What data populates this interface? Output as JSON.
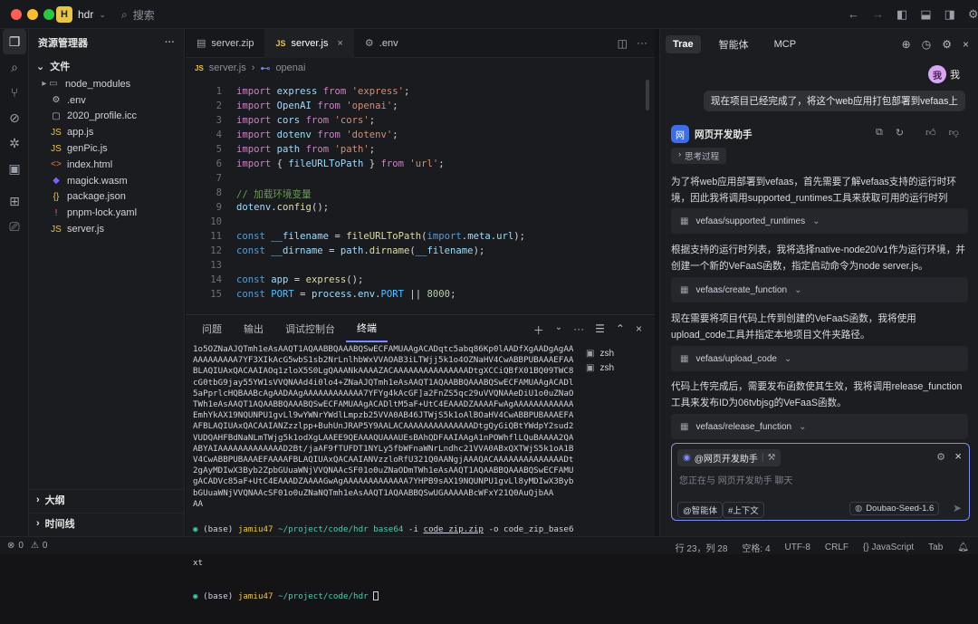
{
  "titlebar": {
    "project_badge": "H",
    "project_name": "hdr",
    "search_placeholder": "搜索"
  },
  "explorer": {
    "title": "资源管理器",
    "section": "文件",
    "files": [
      {
        "name": "node_modules",
        "icon": "folder-icon",
        "color": "#9aa0aa",
        "glyph": "▸"
      },
      {
        "name": ".env",
        "icon": "gear-icon",
        "color": "#b7bac2",
        "glyph": "⚙"
      },
      {
        "name": "2020_profile.icc",
        "icon": "file-icon",
        "color": "#b7bac2",
        "glyph": "▢"
      },
      {
        "name": "app.js",
        "icon": "js-icon",
        "color": "#e8c547",
        "glyph": "JS"
      },
      {
        "name": "genPic.js",
        "icon": "js-icon",
        "color": "#e8c547",
        "glyph": "JS"
      },
      {
        "name": "index.html",
        "icon": "html-icon",
        "color": "#e37933",
        "glyph": "<>"
      },
      {
        "name": "magick.wasm",
        "icon": "wasm-icon",
        "color": "#7b61ff",
        "glyph": "◆"
      },
      {
        "name": "package.json",
        "icon": "json-icon",
        "color": "#e8c547",
        "glyph": "{}"
      },
      {
        "name": "pnpm-lock.yaml",
        "icon": "yaml-icon",
        "color": "#e06c75",
        "glyph": "!"
      },
      {
        "name": "server.js",
        "icon": "js-icon",
        "color": "#e8c547",
        "glyph": "JS"
      }
    ],
    "outline": "大纲",
    "timeline": "时间线"
  },
  "editor": {
    "tabs": [
      {
        "label": "server.zip",
        "icon": "file-icon"
      },
      {
        "label": "server.js",
        "icon": "js-icon"
      },
      {
        "label": ".env",
        "icon": "gear-icon"
      }
    ],
    "breadcrumb": [
      "server.js",
      "openai"
    ],
    "line_numbers": [
      "1",
      "2",
      "3",
      "4",
      "5",
      "6",
      "7",
      "8",
      "9",
      "10",
      "11",
      "12",
      "13",
      "14",
      "15"
    ]
  },
  "panel": {
    "tabs": [
      "问题",
      "输出",
      "调试控制台",
      "终端"
    ],
    "shells": [
      "zsh",
      "zsh"
    ],
    "terminal_lines": [
      "1o5OZNaAJQTmh1eAsAAQT1AQAABBQAAABQSwECFAMUAAgACADqtc5abq86Kp0lAADfXgAADgAgAAAA",
      "AAAAAAAAA7YF3XIkAcG5wbS1sb2NrLnlhbWxVVAOAB3iLTWjj5k1o4OZNaHV4CwABBPUBAAAEFAAAAF",
      "BLAQIUAxQACAAIAOq1zloX5S0LgQAAANkAAAAZACAAAAAAAAAAAAAAADtgXCCiQBfX01BQ09TWC8uX3Bu",
      "cG0tbG9jay55YW1sVVQNAAd4i0lo4+ZNaAJQTmh1eAsAAQT1AQAABBQAAABQSwECFAMUAAgACADltM",
      "5aPprlcHQBAABcAgAADAAgAAAAAAAAAAAA7YFYg4kAcGF]a2FnZS5qc29uVVQNAAeDiU1o0uZNaODm",
      "TWh1eAsAAQT1AQAABBQAAABQSwECFAMUAAgACADltM5aF+UtC4EAAADZAAAAFwAgAAAAAAAAAAAA7Y",
      "EmhYkAX19NQUNPU1gvLl9wYWNrYWdlLmpzb25VVA0AB46JTWjS5k1oAlBOaHV4CwABBPUBAAAEFAAA",
      "AFBLAQIUAxQACAAIANZzzlpp+BuhUnJRAP5Y9AALACAAAAAAAAAAAAAADtgQyGiQBtYWdpY2sud2FzbV",
      "VUDQAHFBdNaNLmTWjg5k1odXgLAAEE9QEAAAQUAAAUEsBAhQDFAAIAAgA1nPOWhflLQuBAAAA2QAA",
      "ABYAIAAAAAAAAAAAAAD2Bt/jaAF9fTUFDT1NYLy5fbWFnaWNrLndhc21VVA0ABxQXTWjS5k1oA1BOaH",
      "V4CwABBPUBAAAEFAAAAFBLAQIUAxQACAAIANVzzloRfU321Q0AANgjAAAQACAAAAAAAAAAAAAADtgZz5",
      "2gAyMDIwX3Byb2ZpbGUuaWNjVVQNAAcSF01o0uZNaODmTWh1eAsAAQT1AQAABBQAAABQSwECFAMUAA",
      "gACADVc85aF+UtC4EAAADZAAAAGwAgAAAAAAAAAAAAA7YHPB9sAX19NQUNPU1gvLl8yMDIwX3Byb2Zp",
      "bGUuaWNjVVQNAAcSF01o0uZNaNQTmh1eAsAAQT1AQAABBQSwUGAAAAABcWFxY21Q0AuQjbAA",
      "AA"
    ],
    "cmd1_prompt": "(base) ",
    "cmd1_user": "jamiu47",
    "cmd1_path": " ~/project/code/hdr ",
    "cmd1_cmd": "base64",
    "cmd1_args": " -i ",
    "cmd1_in": "code_zip.zip",
    "cmd1_rest": " -o code_zip_base64.t",
    "cmd1_wrap": "xt",
    "cmd2_prompt": "(base) ",
    "cmd2_user": "jamiu47",
    "cmd2_path": " ~/project/code/hdr "
  },
  "chat": {
    "tabs": [
      "Trae",
      "智能体",
      "MCP"
    ],
    "user_label": "我",
    "user_avatar": "我",
    "user_message": "现在项目已经完成了，将这个web应用打包部署到vefaas上",
    "assistant_name": "网页开发助手",
    "assistant_avatar": "网",
    "thinking": "思考过程",
    "para1": "为了将web应用部署到vefaas，首先需要了解vefaas支持的运行时环境，因此我将调用supported_runtimes工具来获取可用的运行时列表。",
    "tool1": "vefaas/supported_runtimes",
    "para2": "根据支持的运行时列表，我将选择native-node20/v1作为运行环境，并创建一个新的VeFaaS函数，指定启动命令为node server.js。",
    "tool2": "vefaas/create_function",
    "para3": "现在需要将项目代码上传到创建的VeFaaS函数，我将使用upload_code工具并指定本地项目文件夹路径。",
    "tool3": "vefaas/upload_code",
    "para4": "代码上传完成后，需要发布函数使其生效，我将调用release_function工具来发布ID为06tvbjsg的VeFaaS函数。",
    "tool4": "vefaas/release_function",
    "input_agent": "@网页开发助手",
    "input_placeholder": "您正在与 网页开发助手 聊天",
    "input_btn1": "智能体",
    "input_btn2": "上下文",
    "model": "Doubao-Seed-1.6"
  },
  "statusbar": {
    "errors": "0",
    "warnings": "0",
    "position": "行 23，列 28",
    "spaces": "空格: 4",
    "encoding": "UTF-8",
    "eol": "CRLF",
    "language": "JavaScript",
    "tab": "Tab"
  },
  "colors": {
    "accent": "#7c8cff",
    "brand": "#e8c547",
    "terminal_prompt": "#4ec9b0",
    "user_name": "#e8c547"
  }
}
